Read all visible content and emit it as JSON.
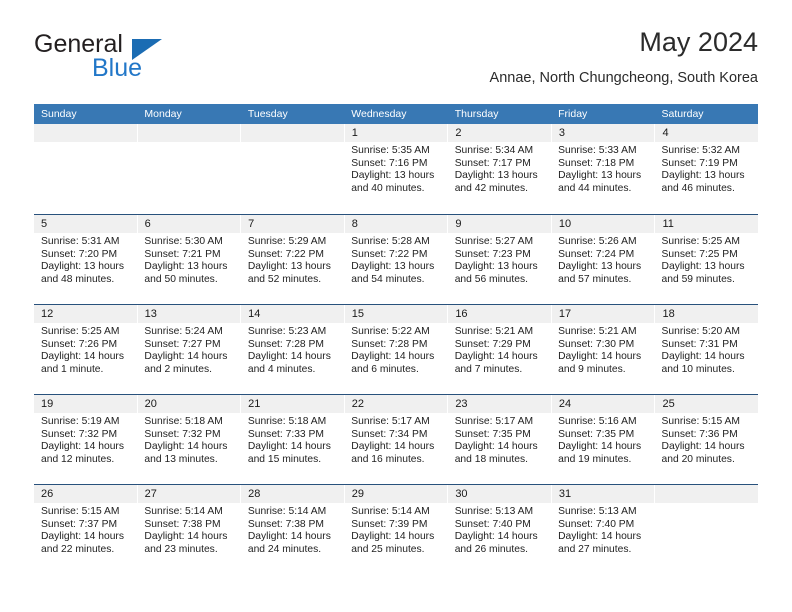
{
  "brand": {
    "name_top": "General",
    "name_bottom": "Blue",
    "triangle_icon": "triangle-icon",
    "color_primary": "#1b6cb3",
    "color_text": "#231f20"
  },
  "header": {
    "title": "May 2024",
    "subtitle": "Annae, North Chungcheong, South Korea"
  },
  "calendar": {
    "header_bg": "#3878b4",
    "header_text_color": "#ffffff",
    "row_divider_color": "#28517c",
    "day_number_band_bg": "#f0f0f0",
    "weekdays": [
      "Sunday",
      "Monday",
      "Tuesday",
      "Wednesday",
      "Thursday",
      "Friday",
      "Saturday"
    ],
    "weeks": [
      [
        {
          "day": "",
          "sunrise": "",
          "sunset": "",
          "daylight_1": "",
          "daylight_2": ""
        },
        {
          "day": "",
          "sunrise": "",
          "sunset": "",
          "daylight_1": "",
          "daylight_2": ""
        },
        {
          "day": "",
          "sunrise": "",
          "sunset": "",
          "daylight_1": "",
          "daylight_2": ""
        },
        {
          "day": "1",
          "sunrise": "Sunrise: 5:35 AM",
          "sunset": "Sunset: 7:16 PM",
          "daylight_1": "Daylight: 13 hours",
          "daylight_2": "and 40 minutes."
        },
        {
          "day": "2",
          "sunrise": "Sunrise: 5:34 AM",
          "sunset": "Sunset: 7:17 PM",
          "daylight_1": "Daylight: 13 hours",
          "daylight_2": "and 42 minutes."
        },
        {
          "day": "3",
          "sunrise": "Sunrise: 5:33 AM",
          "sunset": "Sunset: 7:18 PM",
          "daylight_1": "Daylight: 13 hours",
          "daylight_2": "and 44 minutes."
        },
        {
          "day": "4",
          "sunrise": "Sunrise: 5:32 AM",
          "sunset": "Sunset: 7:19 PM",
          "daylight_1": "Daylight: 13 hours",
          "daylight_2": "and 46 minutes."
        }
      ],
      [
        {
          "day": "5",
          "sunrise": "Sunrise: 5:31 AM",
          "sunset": "Sunset: 7:20 PM",
          "daylight_1": "Daylight: 13 hours",
          "daylight_2": "and 48 minutes."
        },
        {
          "day": "6",
          "sunrise": "Sunrise: 5:30 AM",
          "sunset": "Sunset: 7:21 PM",
          "daylight_1": "Daylight: 13 hours",
          "daylight_2": "and 50 minutes."
        },
        {
          "day": "7",
          "sunrise": "Sunrise: 5:29 AM",
          "sunset": "Sunset: 7:22 PM",
          "daylight_1": "Daylight: 13 hours",
          "daylight_2": "and 52 minutes."
        },
        {
          "day": "8",
          "sunrise": "Sunrise: 5:28 AM",
          "sunset": "Sunset: 7:22 PM",
          "daylight_1": "Daylight: 13 hours",
          "daylight_2": "and 54 minutes."
        },
        {
          "day": "9",
          "sunrise": "Sunrise: 5:27 AM",
          "sunset": "Sunset: 7:23 PM",
          "daylight_1": "Daylight: 13 hours",
          "daylight_2": "and 56 minutes."
        },
        {
          "day": "10",
          "sunrise": "Sunrise: 5:26 AM",
          "sunset": "Sunset: 7:24 PM",
          "daylight_1": "Daylight: 13 hours",
          "daylight_2": "and 57 minutes."
        },
        {
          "day": "11",
          "sunrise": "Sunrise: 5:25 AM",
          "sunset": "Sunset: 7:25 PM",
          "daylight_1": "Daylight: 13 hours",
          "daylight_2": "and 59 minutes."
        }
      ],
      [
        {
          "day": "12",
          "sunrise": "Sunrise: 5:25 AM",
          "sunset": "Sunset: 7:26 PM",
          "daylight_1": "Daylight: 14 hours",
          "daylight_2": "and 1 minute."
        },
        {
          "day": "13",
          "sunrise": "Sunrise: 5:24 AM",
          "sunset": "Sunset: 7:27 PM",
          "daylight_1": "Daylight: 14 hours",
          "daylight_2": "and 2 minutes."
        },
        {
          "day": "14",
          "sunrise": "Sunrise: 5:23 AM",
          "sunset": "Sunset: 7:28 PM",
          "daylight_1": "Daylight: 14 hours",
          "daylight_2": "and 4 minutes."
        },
        {
          "day": "15",
          "sunrise": "Sunrise: 5:22 AM",
          "sunset": "Sunset: 7:28 PM",
          "daylight_1": "Daylight: 14 hours",
          "daylight_2": "and 6 minutes."
        },
        {
          "day": "16",
          "sunrise": "Sunrise: 5:21 AM",
          "sunset": "Sunset: 7:29 PM",
          "daylight_1": "Daylight: 14 hours",
          "daylight_2": "and 7 minutes."
        },
        {
          "day": "17",
          "sunrise": "Sunrise: 5:21 AM",
          "sunset": "Sunset: 7:30 PM",
          "daylight_1": "Daylight: 14 hours",
          "daylight_2": "and 9 minutes."
        },
        {
          "day": "18",
          "sunrise": "Sunrise: 5:20 AM",
          "sunset": "Sunset: 7:31 PM",
          "daylight_1": "Daylight: 14 hours",
          "daylight_2": "and 10 minutes."
        }
      ],
      [
        {
          "day": "19",
          "sunrise": "Sunrise: 5:19 AM",
          "sunset": "Sunset: 7:32 PM",
          "daylight_1": "Daylight: 14 hours",
          "daylight_2": "and 12 minutes."
        },
        {
          "day": "20",
          "sunrise": "Sunrise: 5:18 AM",
          "sunset": "Sunset: 7:32 PM",
          "daylight_1": "Daylight: 14 hours",
          "daylight_2": "and 13 minutes."
        },
        {
          "day": "21",
          "sunrise": "Sunrise: 5:18 AM",
          "sunset": "Sunset: 7:33 PM",
          "daylight_1": "Daylight: 14 hours",
          "daylight_2": "and 15 minutes."
        },
        {
          "day": "22",
          "sunrise": "Sunrise: 5:17 AM",
          "sunset": "Sunset: 7:34 PM",
          "daylight_1": "Daylight: 14 hours",
          "daylight_2": "and 16 minutes."
        },
        {
          "day": "23",
          "sunrise": "Sunrise: 5:17 AM",
          "sunset": "Sunset: 7:35 PM",
          "daylight_1": "Daylight: 14 hours",
          "daylight_2": "and 18 minutes."
        },
        {
          "day": "24",
          "sunrise": "Sunrise: 5:16 AM",
          "sunset": "Sunset: 7:35 PM",
          "daylight_1": "Daylight: 14 hours",
          "daylight_2": "and 19 minutes."
        },
        {
          "day": "25",
          "sunrise": "Sunrise: 5:15 AM",
          "sunset": "Sunset: 7:36 PM",
          "daylight_1": "Daylight: 14 hours",
          "daylight_2": "and 20 minutes."
        }
      ],
      [
        {
          "day": "26",
          "sunrise": "Sunrise: 5:15 AM",
          "sunset": "Sunset: 7:37 PM",
          "daylight_1": "Daylight: 14 hours",
          "daylight_2": "and 22 minutes."
        },
        {
          "day": "27",
          "sunrise": "Sunrise: 5:14 AM",
          "sunset": "Sunset: 7:38 PM",
          "daylight_1": "Daylight: 14 hours",
          "daylight_2": "and 23 minutes."
        },
        {
          "day": "28",
          "sunrise": "Sunrise: 5:14 AM",
          "sunset": "Sunset: 7:38 PM",
          "daylight_1": "Daylight: 14 hours",
          "daylight_2": "and 24 minutes."
        },
        {
          "day": "29",
          "sunrise": "Sunrise: 5:14 AM",
          "sunset": "Sunset: 7:39 PM",
          "daylight_1": "Daylight: 14 hours",
          "daylight_2": "and 25 minutes."
        },
        {
          "day": "30",
          "sunrise": "Sunrise: 5:13 AM",
          "sunset": "Sunset: 7:40 PM",
          "daylight_1": "Daylight: 14 hours",
          "daylight_2": "and 26 minutes."
        },
        {
          "day": "31",
          "sunrise": "Sunrise: 5:13 AM",
          "sunset": "Sunset: 7:40 PM",
          "daylight_1": "Daylight: 14 hours",
          "daylight_2": "and 27 minutes."
        },
        {
          "day": "",
          "sunrise": "",
          "sunset": "",
          "daylight_1": "",
          "daylight_2": ""
        }
      ]
    ]
  }
}
